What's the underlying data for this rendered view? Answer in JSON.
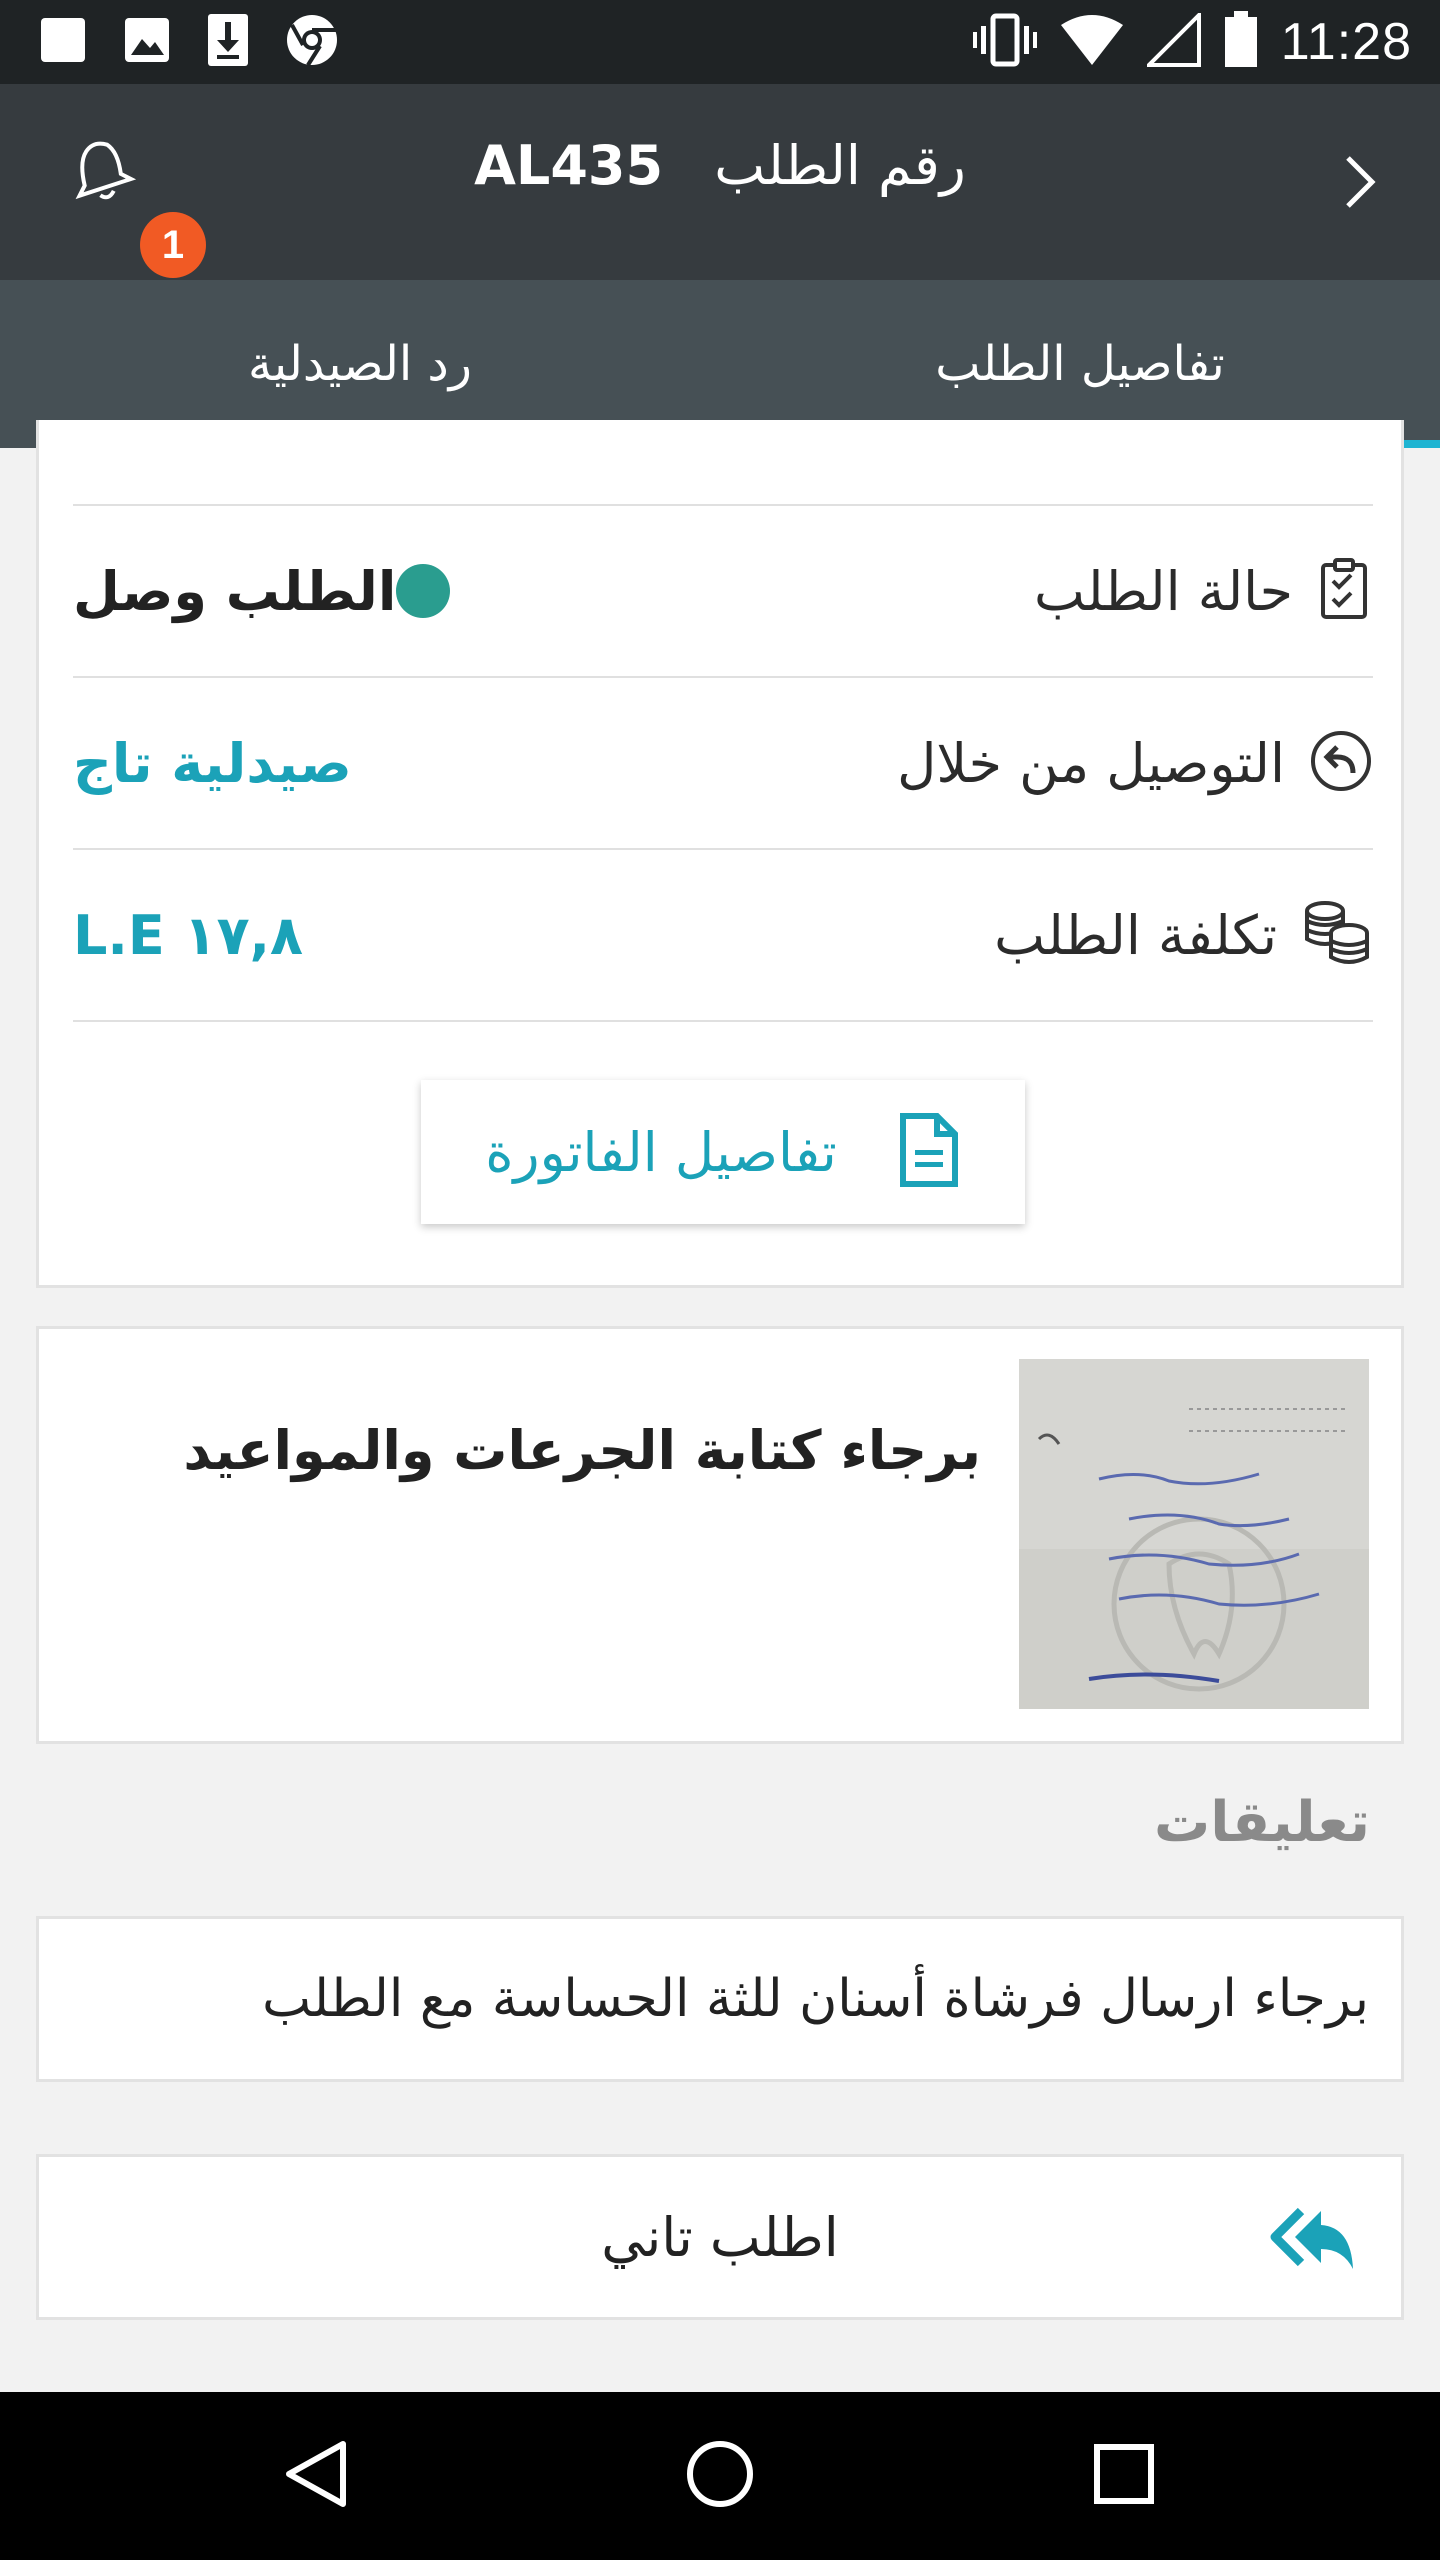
{
  "status_bar": {
    "time": "11:28",
    "left_icons": [
      "blank-notification-icon",
      "image-icon",
      "download-icon",
      "chrome-icon"
    ],
    "right_icons": [
      "vibrate-icon",
      "wifi-icon",
      "signal-icon",
      "battery-icon"
    ]
  },
  "app_bar": {
    "title_label": "رقم الطلب",
    "order_number": "AL435",
    "notification_count": "1",
    "icons": [
      "back-chevron-icon",
      "bell-icon"
    ]
  },
  "tabs": [
    {
      "label": "تفاصيل الطلب",
      "active": true
    },
    {
      "label": "رد الصيدلية",
      "active": false
    }
  ],
  "details": {
    "rows": [
      {
        "label": "حالة الطلب",
        "value": "الطلب وصل",
        "icon": "checklist-icon"
      },
      {
        "label": "التوصيل من خلال",
        "value": "صيدلية تاج",
        "icon": "reply-circle-icon"
      },
      {
        "label": "تكلفة الطلب",
        "value": "L.E ١٧,٨",
        "icon": "coins-icon"
      }
    ],
    "invoice_button": "تفاصيل الفاتورة"
  },
  "prescription": {
    "note": "برجاء كتابة الجرعات والمواعيد",
    "image_icon": "prescription-photo"
  },
  "comments": {
    "title": "تعليقات",
    "text": "برجاء ارسال فرشاة أسنان للثة الحساسة مع الطلب"
  },
  "reorder": {
    "label": "اطلب تاني",
    "icon": "reply-all-icon"
  },
  "colors": {
    "accent": "#1eb4d2",
    "teal_text": "#1ba2b8",
    "status_dot": "#2a9d8f",
    "badge": "#f15a24",
    "appbar": "#363b3f",
    "tabs_bg": "#465055"
  }
}
